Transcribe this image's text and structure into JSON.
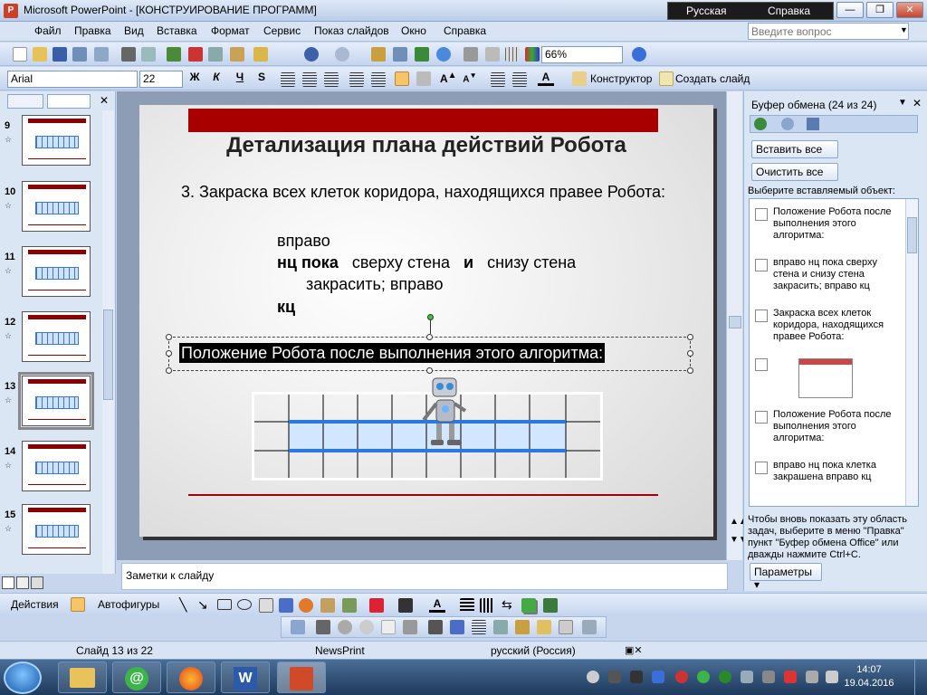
{
  "window": {
    "title": "Microsoft PowerPoint - [КОНСТРУИРОВАНИЕ ПРОГРАММ]",
    "lang": "Русская",
    "help": "Справка"
  },
  "menu": [
    "Файл",
    "Правка",
    "Вид",
    "Вставка",
    "Формат",
    "Сервис",
    "Показ слайдов",
    "Окно",
    "Справка"
  ],
  "search": {
    "placeholder": "Введите вопрос"
  },
  "toolbar": {
    "zoom": "66%"
  },
  "format": {
    "font": "Arial",
    "size": "22",
    "bold": "Ж",
    "italic": "К",
    "underline": "Ч",
    "shadow": "S",
    "designer": "Конструктор",
    "new_slide": "Создать слайд"
  },
  "thumbnails": {
    "numbers": [
      "9",
      "10",
      "11",
      "12",
      "13",
      "14",
      "15"
    ],
    "selected": "13"
  },
  "slide": {
    "title": "Детализация плана действий Робота",
    "para": "3. Закраска всех клеток коридора, находящихся правее Робота:",
    "code1": "вправо",
    "code2_kw": "нц пока",
    "code2_a": "сверху стена",
    "code2_and": "и",
    "code2_b": "снизу стена",
    "code3": "закрасить;  вправо",
    "code4": "кц",
    "caption": "Положение Робота после выполнения этого алгоритма:"
  },
  "notes": {
    "placeholder": "Заметки к слайду"
  },
  "clipboard": {
    "title": "Буфер обмена (24 из 24)",
    "paste_all": "Вставить все",
    "clear_all": "Очистить все",
    "choose": "Выберите вставляемый объект:",
    "items": [
      "Положение Робота после выполнения этого алгоритма:",
      "вправо нц пока сверху стена и снизу стена закрасить; вправо кц",
      "Закраска всех клеток коридора, находящихся правее Робота:",
      "Положение Робота после выполнения этого алгоритма:",
      "вправо нц пока клетка закрашена вправо кц"
    ],
    "hint": "Чтобы вновь показать эту область задач, выберите в меню \"Правка\" пункт \"Буфер обмена Office\" или дважды нажмите Ctrl+C.",
    "options": "Параметры"
  },
  "drawing": {
    "actions": "Действия",
    "autoshapes": "Автофигуры"
  },
  "status": {
    "slide": "Слайд 13 из 22",
    "design": "NewsPrint",
    "lang": "русский (Россия)"
  },
  "clock": {
    "time": "14:07",
    "date": "19.04.2016"
  }
}
